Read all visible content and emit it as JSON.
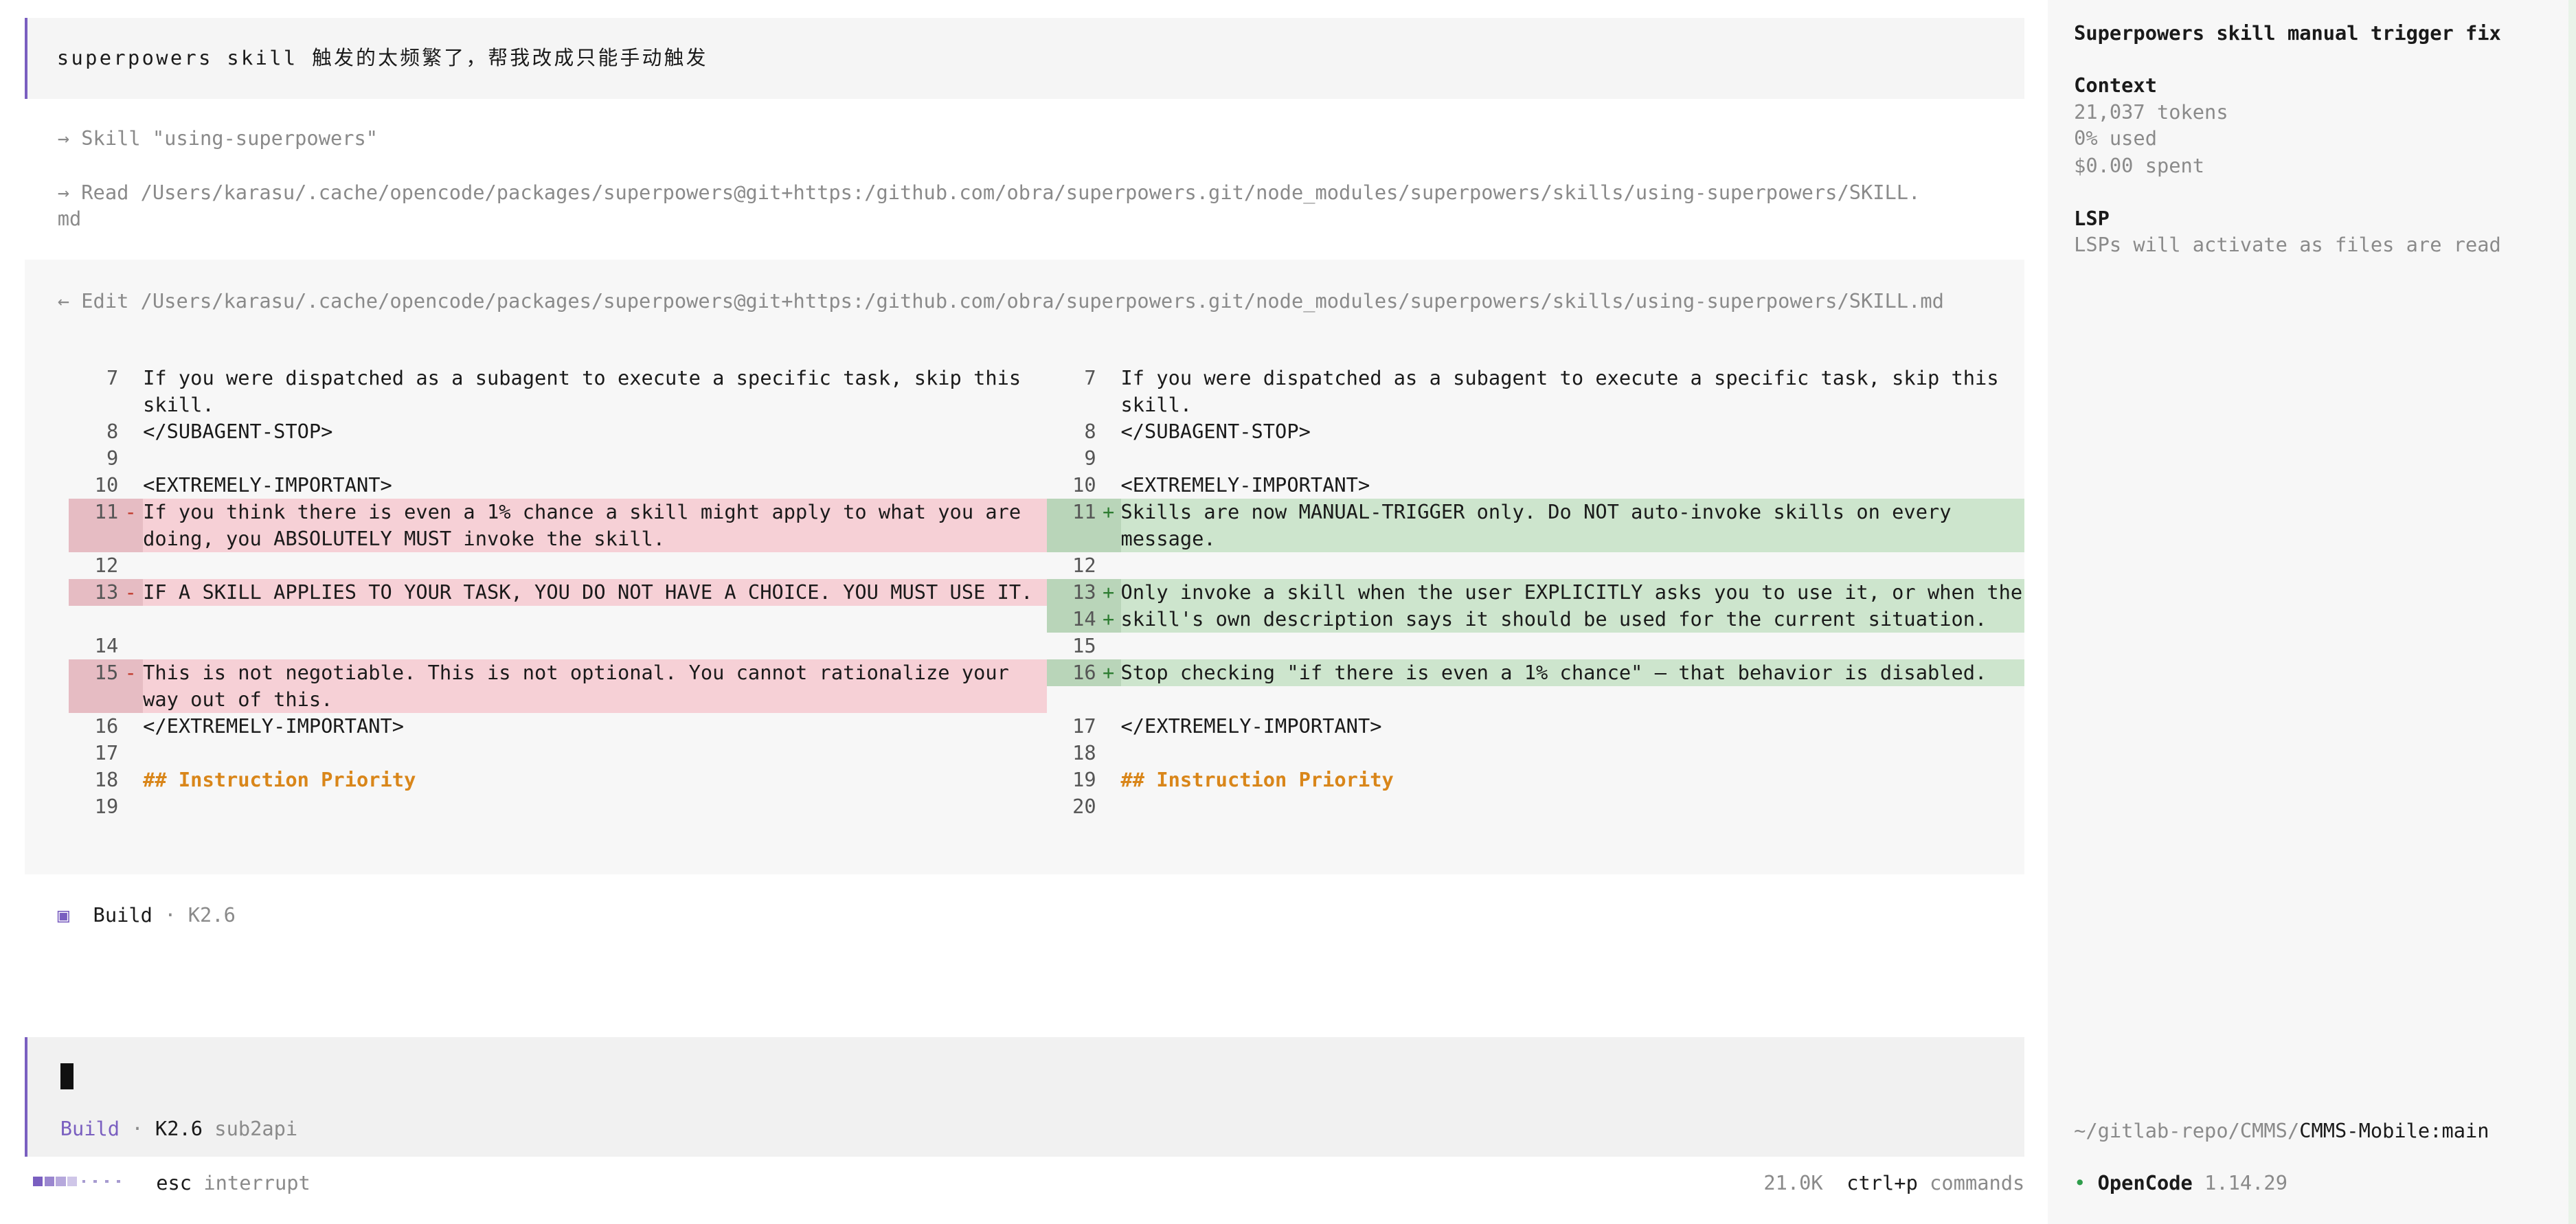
{
  "user_message": "superpowers skill 触发的太频繁了，帮我改成只能手动触发",
  "tool_calls": [
    {
      "arrow": "→",
      "label": "Skill \"using-superpowers\""
    },
    {
      "arrow": "→",
      "label": "Read /Users/karasu/.cache/opencode/packages/superpowers@git+https:/github.com/obra/superpowers.git/node_modules/superpowers/skills/using-superpowers/SKILL.",
      "continuation": "md"
    }
  ],
  "edit": {
    "arrow": "←",
    "label": "Edit /Users/karasu/.cache/opencode/packages/superpowers@git+https:/github.com/obra/superpowers.git/node_modules/superpowers/skills/using-superpowers/SKILL.md",
    "left": [
      {
        "num": "7",
        "mark": "",
        "type": "ctx",
        "text": "If you were dispatched as a subagent to execute a specific task, skip this skill."
      },
      {
        "num": "8",
        "mark": "",
        "type": "ctx",
        "text": "</SUBAGENT-STOP>"
      },
      {
        "num": "9",
        "mark": "",
        "type": "ctx",
        "text": ""
      },
      {
        "num": "10",
        "mark": "",
        "type": "ctx",
        "text": "<EXTREMELY-IMPORTANT>"
      },
      {
        "num": "11",
        "mark": "-",
        "type": "del",
        "text": "If you think there is even a 1% chance a skill might apply to what you are doing, you ABSOLUTELY MUST invoke the skill."
      },
      {
        "num": "12",
        "mark": "",
        "type": "ctx",
        "text": ""
      },
      {
        "num": "13",
        "mark": "-",
        "type": "del",
        "text": "IF A SKILL APPLIES TO YOUR TASK, YOU DO NOT HAVE A CHOICE. YOU MUST USE IT."
      },
      {
        "num": "",
        "mark": "",
        "type": "pad",
        "text": ""
      },
      {
        "num": "14",
        "mark": "",
        "type": "ctx",
        "text": ""
      },
      {
        "num": "15",
        "mark": "-",
        "type": "del",
        "text": "This is not negotiable. This is not optional. You cannot rationalize your way out of this."
      },
      {
        "num": "16",
        "mark": "",
        "type": "ctx",
        "text": "</EXTREMELY-IMPORTANT>"
      },
      {
        "num": "17",
        "mark": "",
        "type": "ctx",
        "text": ""
      },
      {
        "num": "18",
        "mark": "",
        "type": "heading",
        "text": "## Instruction Priority"
      },
      {
        "num": "19",
        "mark": "",
        "type": "ctx",
        "text": ""
      }
    ],
    "right": [
      {
        "num": "7",
        "mark": "",
        "type": "ctx",
        "text": "If you were dispatched as a subagent to execute a specific task, skip this skill."
      },
      {
        "num": "8",
        "mark": "",
        "type": "ctx",
        "text": "</SUBAGENT-STOP>"
      },
      {
        "num": "9",
        "mark": "",
        "type": "ctx",
        "text": ""
      },
      {
        "num": "10",
        "mark": "",
        "type": "ctx",
        "text": "<EXTREMELY-IMPORTANT>"
      },
      {
        "num": "11",
        "mark": "+",
        "type": "add",
        "text": "Skills are now MANUAL-TRIGGER only. Do NOT auto-invoke skills on every message."
      },
      {
        "num": "12",
        "mark": "",
        "type": "ctx",
        "text": ""
      },
      {
        "num": "13",
        "mark": "+",
        "type": "add",
        "text": "Only invoke a skill when the user EXPLICITLY asks you to use it, or when the"
      },
      {
        "num": "14",
        "mark": "+",
        "type": "add",
        "text": "skill's own description says it should be used for the current situation."
      },
      {
        "num": "15",
        "mark": "",
        "type": "ctx",
        "text": ""
      },
      {
        "num": "16",
        "mark": "+",
        "type": "add",
        "text": "Stop checking \"if there is even a 1% chance\" — that behavior is disabled."
      },
      {
        "num": "",
        "mark": "",
        "type": "pad",
        "text": ""
      },
      {
        "num": "17",
        "mark": "",
        "type": "ctx",
        "text": "</EXTREMELY-IMPORTANT>"
      },
      {
        "num": "18",
        "mark": "",
        "type": "ctx",
        "text": ""
      },
      {
        "num": "19",
        "mark": "",
        "type": "heading",
        "text": "## Instruction Priority"
      },
      {
        "num": "20",
        "mark": "",
        "type": "ctx",
        "text": ""
      }
    ]
  },
  "build_status": {
    "icon": "▣",
    "agent": "Build",
    "sep": "·",
    "model": "K2.6"
  },
  "prompt": {
    "agent": "Build",
    "sep": "·",
    "model": "K2.6",
    "provider": "sub2api"
  },
  "status_bar": {
    "key": "esc",
    "action": "interrupt",
    "tokens": "21.0K",
    "cmd_key": "ctrl+p",
    "cmd_label": "commands"
  },
  "sidebar": {
    "title": "Superpowers skill manual trigger fix",
    "context_heading": "Context",
    "tokens": "21,037 tokens",
    "used": "0% used",
    "spent": "$0.00 spent",
    "lsp_heading": "LSP",
    "lsp_text": "LSPs will activate as files are read",
    "path_prefix": "~/gitlab-repo/CMMS/",
    "path_repo": "CMMS-Mobile:main",
    "app_dot": "•",
    "app_name": "OpenCode",
    "app_version": "1.14.29"
  },
  "colors": {
    "accent": "#7a5fc0",
    "deletion": "#f6d0d6",
    "addition": "#cde5cd",
    "heading": "#d9861a",
    "status_dot": "#2e9d4b"
  }
}
